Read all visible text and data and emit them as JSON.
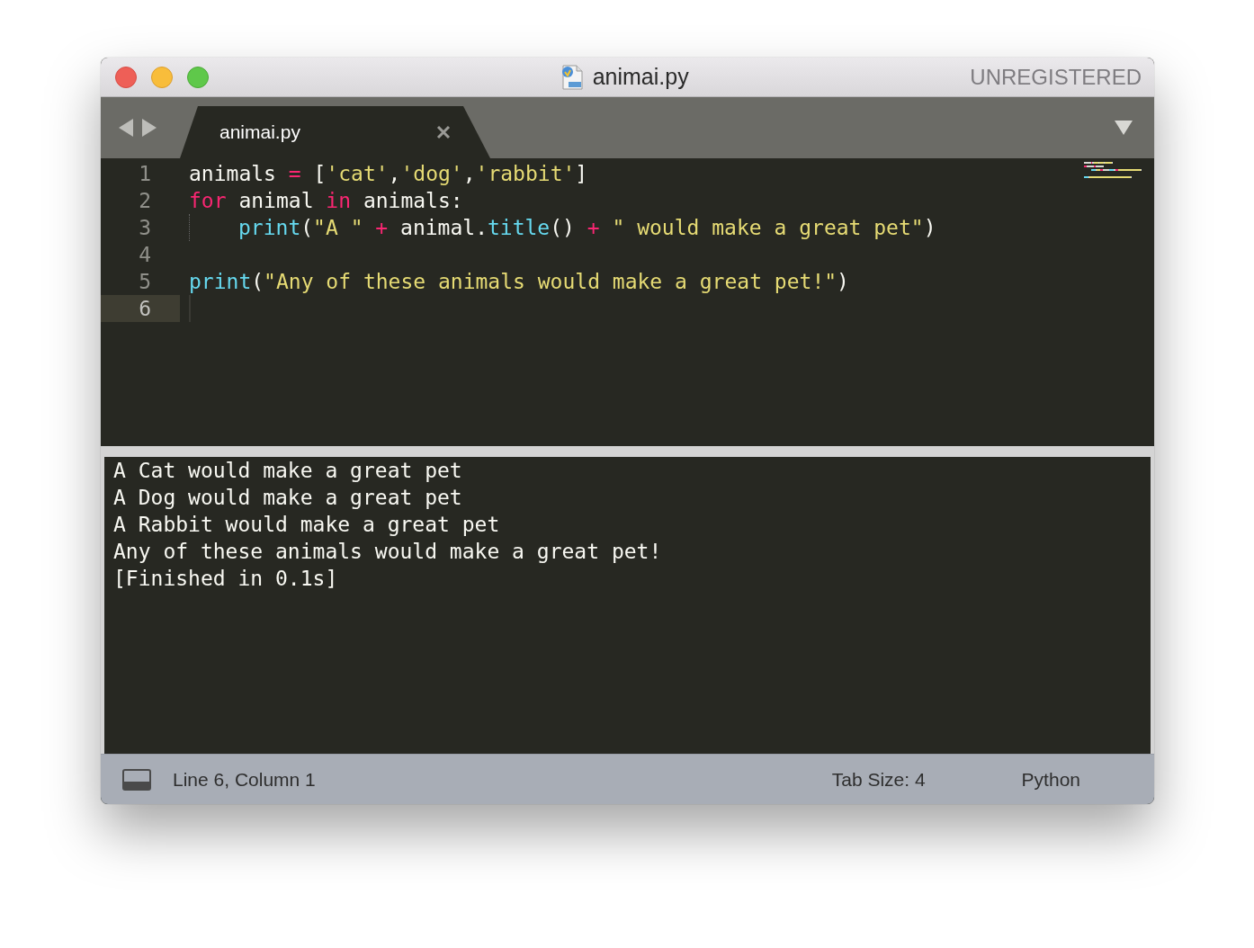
{
  "window": {
    "title": "animai.py",
    "license": "UNREGISTERED"
  },
  "tabs": [
    {
      "label": "animai.py",
      "selected": true
    }
  ],
  "editor": {
    "lines": [
      {
        "number": "1",
        "current": false,
        "indent": false,
        "tokens": [
          {
            "text": "animals ",
            "kind": "plain"
          },
          {
            "text": "=",
            "kind": "operator"
          },
          {
            "text": " [",
            "kind": "plain"
          },
          {
            "text": "'cat'",
            "kind": "string"
          },
          {
            "text": ",",
            "kind": "plain"
          },
          {
            "text": "'dog'",
            "kind": "string"
          },
          {
            "text": ",",
            "kind": "plain"
          },
          {
            "text": "'rabbit'",
            "kind": "string"
          },
          {
            "text": "]",
            "kind": "plain"
          }
        ]
      },
      {
        "number": "2",
        "current": false,
        "indent": false,
        "tokens": [
          {
            "text": "for",
            "kind": "keyword"
          },
          {
            "text": " animal ",
            "kind": "plain"
          },
          {
            "text": "in",
            "kind": "keyword"
          },
          {
            "text": " animals:",
            "kind": "plain"
          }
        ]
      },
      {
        "number": "3",
        "current": false,
        "indent": true,
        "tokens": [
          {
            "text": "print",
            "kind": "function"
          },
          {
            "text": "(",
            "kind": "plain"
          },
          {
            "text": "\"A \"",
            "kind": "string"
          },
          {
            "text": " + ",
            "kind": "operator"
          },
          {
            "text": "animal.",
            "kind": "plain"
          },
          {
            "text": "title",
            "kind": "function"
          },
          {
            "text": "()",
            "kind": "plain"
          },
          {
            "text": " + ",
            "kind": "operator"
          },
          {
            "text": "\" would make a great pet\"",
            "kind": "string"
          },
          {
            "text": ")",
            "kind": "plain"
          }
        ]
      },
      {
        "number": "4",
        "current": false,
        "indent": false
      },
      {
        "number": "5",
        "current": false,
        "indent": false,
        "tokens": [
          {
            "text": "print",
            "kind": "function"
          },
          {
            "text": "(",
            "kind": "plain"
          },
          {
            "text": "\"Any of these animals would make a great pet!\"",
            "kind": "string"
          },
          {
            "text": ")",
            "kind": "plain"
          }
        ]
      },
      {
        "number": "6",
        "current": true,
        "indent": false
      }
    ]
  },
  "output": {
    "lines": [
      "A Cat would make a great pet",
      "A Dog would make a great pet",
      "A Rabbit would make a great pet",
      "Any of these animals would make a great pet!",
      "[Finished in 0.1s]"
    ]
  },
  "status_bar": {
    "position": "Line 6, Column 1",
    "tab_size": "Tab Size: 4",
    "syntax": "Python"
  }
}
